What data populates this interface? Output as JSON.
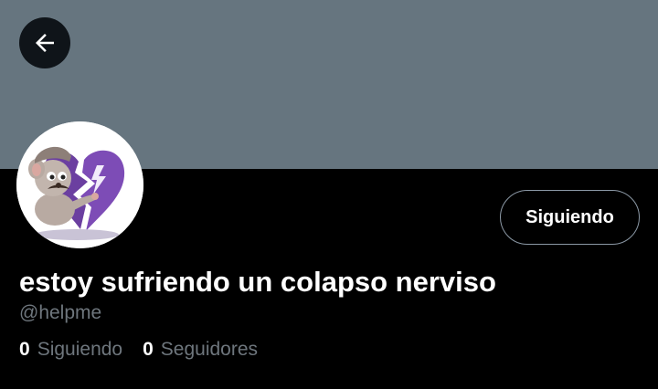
{
  "profile": {
    "display_name": "estoy sufriendo un colapso nerviso",
    "handle": "@helpme",
    "follow_button_label": "Siguiendo"
  },
  "stats": {
    "following_count": "0",
    "following_label": "Siguiendo",
    "followers_count": "0",
    "followers_label": "Seguidores"
  },
  "colors": {
    "banner": "#66757f",
    "background": "#000000",
    "secondary_text": "#6e767d",
    "heart": "#6b3fa0"
  },
  "icons": {
    "back": "back-arrow-icon",
    "avatar": "broken-heart-mouse-image"
  }
}
